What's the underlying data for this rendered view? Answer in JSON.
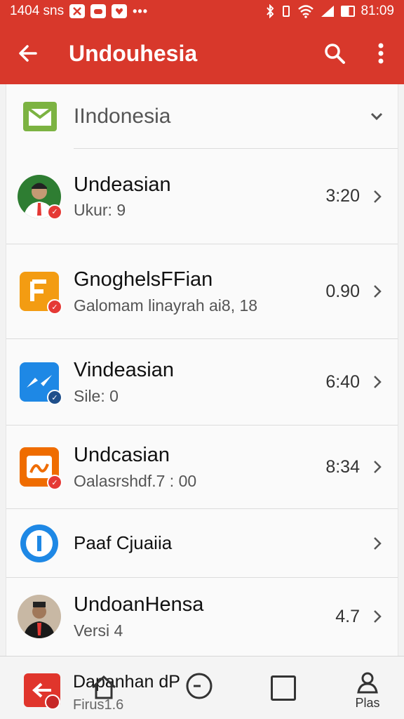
{
  "status_bar": {
    "left_text": "1404 sns",
    "time": "81:09",
    "more": "•••"
  },
  "app_bar": {
    "title": "Undouhesia"
  },
  "section": {
    "title": "IIndonesia"
  },
  "rows": [
    {
      "title": "Undeasian",
      "subtitle": "Ukur: 9",
      "value": "3:20"
    },
    {
      "title": "GnoghelsFFian",
      "subtitle": "Galomam linayrah ai8, 18",
      "value": "0.90"
    },
    {
      "title": "Vindeasian",
      "subtitle": "Sile: 0",
      "value": "6:40"
    },
    {
      "title": "Undcasian",
      "subtitle": "Oalasrshdf.7 : 00",
      "value": "8:34"
    },
    {
      "title": "Paaf Cjuaiia",
      "subtitle": "",
      "value": ""
    },
    {
      "title": "UndoanHensa",
      "subtitle": "Versi 4",
      "value": "4.7"
    }
  ],
  "bottom_nav": {
    "title": "Dapanhan dP",
    "subtitle": "Firus1.6",
    "profile_label": "Plas"
  },
  "colors": {
    "brand_red": "#d8382b",
    "badge_red": "#e53935",
    "badge_blue": "#1f4f8b",
    "icon_orange": "#f39c12",
    "icon_blue": "#1e88e5",
    "folder_green": "#7cb342"
  }
}
